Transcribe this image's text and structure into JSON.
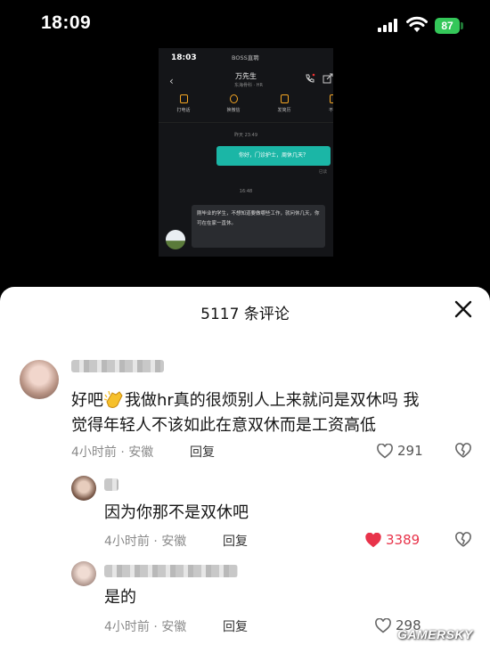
{
  "status_bar": {
    "time": "18:09",
    "battery": "87"
  },
  "chat_screenshot": {
    "time": "18:03",
    "app_name": "BOSS直聘",
    "contact_name": "万先生",
    "contact_sub": "东海骨科 · HR",
    "tools": [
      "打电话",
      "换微信",
      "发简历",
      "不感"
    ],
    "stamp_1": "昨天 23:49",
    "outgoing_message": "你好，门诊护士，周休几天？",
    "read_mark": "已读",
    "stamp_2": "16:48",
    "incoming_message": "刚毕业的学生，不想知道要做哪些工作，就问休几天，你可在在家一直休。"
  },
  "comments_panel": {
    "title": "5117 条评论",
    "close_icon": "close-icon",
    "comments": [
      {
        "text_before_emoji": "好吧",
        "text_after_emoji": "我做hr真的很烦别人上来就问是双休吗 我",
        "text_line2": "觉得年轻人不该如此在意双休而是工资高低",
        "meta": "4小时前 · 安徽",
        "reply_label": "回复",
        "likes": "291",
        "liked": false
      },
      {
        "text": "因为你那不是双休吧",
        "meta": "4小时前 · 安徽",
        "reply_label": "回复",
        "likes": "3389",
        "liked": true
      },
      {
        "text": "是的",
        "meta": "4小时前 · 安徽",
        "reply_label": "回复",
        "likes": "298",
        "liked": false
      }
    ]
  },
  "watermark": "GAMERSKY",
  "colors": {
    "like_active": "#e8334a",
    "chat_bubble_out": "#1bb6a6",
    "battery": "#34c759"
  }
}
